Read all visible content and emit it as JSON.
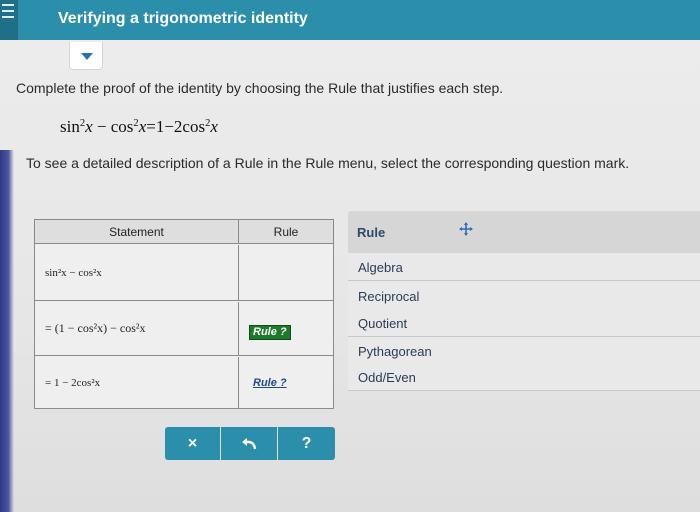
{
  "header": {
    "title": "Verifying a trigonometric identity"
  },
  "instructions": {
    "prompt": "Complete the proof of the identity by choosing the Rule that justifies each step.",
    "hint": "To see a detailed description of a Rule in the Rule menu, select the corresponding question mark."
  },
  "identity": {
    "lhs_a": "sin",
    "exp": "2",
    "var": "x",
    "minus": "−",
    "rhs_b": "cos",
    "equals": "=",
    "one": "1",
    "coef": "2cos"
  },
  "proof_table": {
    "headers": {
      "statement": "Statement",
      "rule": "Rule"
    },
    "rows": [
      {
        "statement": "sin²x − cos²x",
        "rule": ""
      },
      {
        "statement": "= (1 − cos²x) − cos²x",
        "rule": "Rule ?"
      },
      {
        "statement": "= 1 − 2cos²x",
        "rule": "Rule ?"
      }
    ]
  },
  "rule_menu": {
    "title": "Rule",
    "move_icon": "move-icon",
    "items": [
      "Algebra",
      "Reciprocal",
      "Quotient",
      "Pythagorean",
      "Odd/Even"
    ]
  },
  "actions": {
    "clear_label": "×",
    "undo_icon": "undo-icon",
    "help_label": "?"
  },
  "colors": {
    "header_bg": "#2b8fab",
    "filled_rule": "#1d7a2a"
  }
}
